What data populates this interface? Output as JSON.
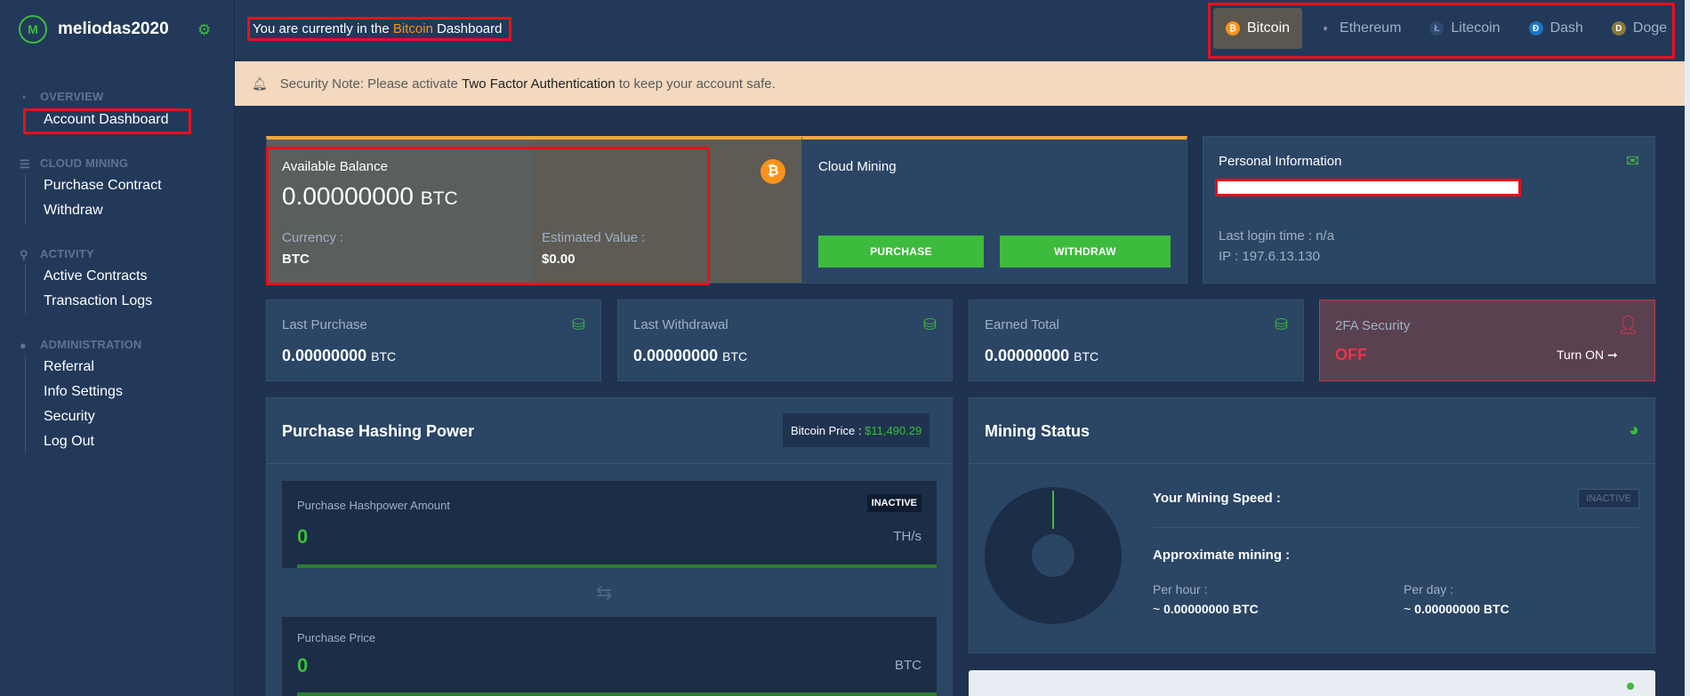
{
  "brand": {
    "name": "meliodas2020",
    "logo_letter": "M"
  },
  "sidebar": {
    "overview": {
      "title": "OVERVIEW",
      "items": [
        "Account Dashboard"
      ]
    },
    "cloud_mining": {
      "title": "CLOUD MINING",
      "items": [
        "Purchase Contract",
        "Withdraw"
      ]
    },
    "activity": {
      "title": "ACTIVITY",
      "items": [
        "Active Contracts",
        "Transaction Logs"
      ]
    },
    "administration": {
      "title": "ADMINISTRATION",
      "items": [
        "Referral",
        "Info Settings",
        "Security",
        "Log Out"
      ]
    }
  },
  "header": {
    "current_prefix": "You are currently in the",
    "current_coin": "Bitcoin",
    "current_suffix": "Dashboard"
  },
  "tabs": [
    {
      "label": "Bitcoin",
      "glyph": "₿",
      "color": "#f7931a"
    },
    {
      "label": "Ethereum",
      "glyph": "♦",
      "color": "#8c8c9c"
    },
    {
      "label": "Litecoin",
      "glyph": "Ł",
      "color": "#345d9d"
    },
    {
      "label": "Dash",
      "glyph": "Đ",
      "color": "#1c75bc"
    },
    {
      "label": "Doge",
      "glyph": "D",
      "color": "#c2a633"
    }
  ],
  "notice": {
    "prefix": "Security Note: Please activate",
    "link": "Two Factor Authentication",
    "suffix": "to keep your account safe."
  },
  "balance": {
    "title": "Available Balance",
    "amount": "0.00000000",
    "unit": "BTC",
    "currency_label": "Currency :",
    "currency_value": "BTC",
    "estimated_label": "Estimated Value :",
    "estimated_value": "$0.00"
  },
  "cloud_mining": {
    "title": "Cloud Mining",
    "purchase": "PURCHASE",
    "withdraw": "WITHDRAW"
  },
  "personal": {
    "title": "Personal Information",
    "last_login": "Last login time : n/a",
    "ip": "IP : 197.6.13.130"
  },
  "stats": [
    {
      "title": "Last Purchase",
      "value": "0.00000000",
      "unit": "BTC"
    },
    {
      "title": "Last Withdrawal",
      "value": "0.00000000",
      "unit": "BTC"
    },
    {
      "title": "Earned Total",
      "value": "0.00000000",
      "unit": "BTC"
    }
  ],
  "twofa": {
    "title": "2FA Security",
    "status": "OFF",
    "action": "Turn ON ➞"
  },
  "hashing": {
    "title": "Purchase Hashing Power",
    "price_label": "Bitcoin Price :",
    "price_value": "$11,490.29",
    "amount_label": "Purchase Hashpower Amount",
    "amount_value": "0",
    "amount_unit": "TH/s",
    "badge": "INACTIVE",
    "price_box_label": "Purchase Price",
    "price_box_value": "0",
    "price_box_unit": "BTC"
  },
  "mining_status": {
    "title": "Mining Status",
    "speed_label": "Your Mining Speed :",
    "badge": "INACTIVE",
    "approx_label": "Approximate mining :",
    "per_hour_label": "Per hour :",
    "per_hour_value": "0.00000000 BTC",
    "per_day_label": "Per day :",
    "per_day_value": "0.00000000 BTC",
    "approx_prefix": "~"
  }
}
